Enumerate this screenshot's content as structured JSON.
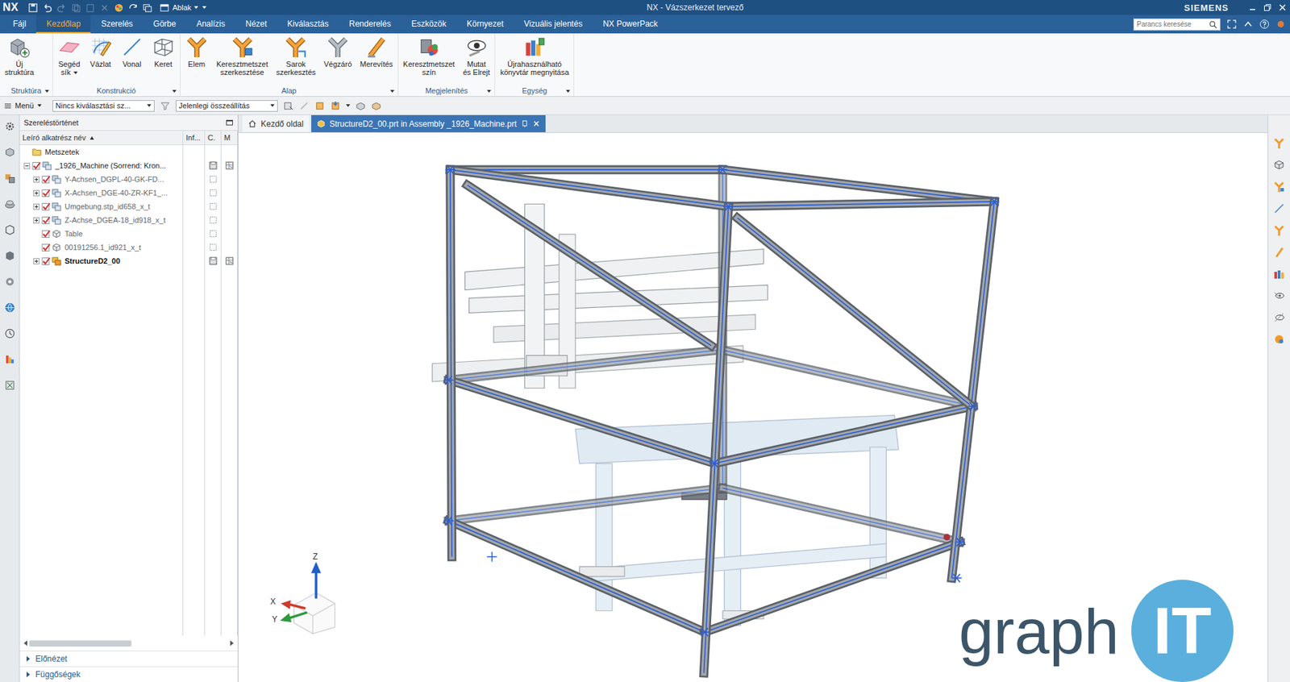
{
  "window": {
    "app": "NX",
    "title": "NX - Vázszerkezet tervező",
    "brand": "SIEMENS",
    "quick_menu": "Ablak"
  },
  "menu_tabs": [
    {
      "label": "Fájl",
      "selected": false
    },
    {
      "label": "Kezdőlap",
      "selected": true
    },
    {
      "label": "Szerelés",
      "selected": false
    },
    {
      "label": "Görbe",
      "selected": false
    },
    {
      "label": "Analízis",
      "selected": false
    },
    {
      "label": "Nézet",
      "selected": false
    },
    {
      "label": "Kiválasztás",
      "selected": false
    },
    {
      "label": "Renderelés",
      "selected": false
    },
    {
      "label": "Eszközök",
      "selected": false
    },
    {
      "label": "Környezet",
      "selected": false
    },
    {
      "label": "Vizuális jelentés",
      "selected": false
    },
    {
      "label": "NX PowerPack",
      "selected": false
    }
  ],
  "command_search": {
    "placeholder": "Parancs keresése"
  },
  "ribbon_groups": [
    {
      "label": "Struktúra",
      "has_menu": true,
      "commands": [
        {
          "label": "Új\nstruktúra",
          "kind": "structure",
          "has_menu": false
        }
      ]
    },
    {
      "label": "Konstrukció",
      "has_menu": true,
      "commands": [
        {
          "label": "Segéd\nsík",
          "kind": "plane",
          "has_menu": true
        },
        {
          "label": "Vázlat",
          "kind": "sketch",
          "has_menu": false
        },
        {
          "label": "Vonal",
          "kind": "line",
          "has_menu": false
        },
        {
          "label": "Keret",
          "kind": "frame",
          "has_menu": false
        }
      ]
    },
    {
      "label": "Alap",
      "has_menu": true,
      "commands": [
        {
          "label": "Elem",
          "kind": "member",
          "has_menu": false
        },
        {
          "label": "Keresztmetszet\nszerkesztése",
          "kind": "section",
          "has_menu": false
        },
        {
          "label": "Sarok\nszerkesztés",
          "kind": "corner",
          "has_menu": false
        },
        {
          "label": "Végzáró",
          "kind": "endcap",
          "has_menu": false
        },
        {
          "label": "Merevítés",
          "kind": "brace",
          "has_menu": false
        }
      ]
    },
    {
      "label": "Megjelenítés",
      "has_menu": true,
      "commands": [
        {
          "label": "Keresztmetszet\nszín",
          "kind": "color",
          "has_menu": false
        },
        {
          "label": "Mutat\nés Elrejt",
          "kind": "showhide",
          "has_menu": false
        }
      ]
    },
    {
      "label": "Egység",
      "has_menu": true,
      "commands": [
        {
          "label": "Újrahasználható\nkönyvtár megnyitása",
          "kind": "library",
          "has_menu": false
        }
      ]
    }
  ],
  "selection_bar": {
    "menu": "Menü",
    "filters": [
      "Nincs kiválasztási sz...",
      "Jelenlegi összeállítás"
    ]
  },
  "navigator": {
    "title": "Szereléstörténet",
    "columns": [
      {
        "label": "Leíró alkatrész név",
        "sort": "asc"
      },
      {
        "label": "Inf...",
        "sort": "none"
      },
      {
        "label": "C.",
        "sort": "none"
      },
      {
        "label": "M",
        "sort": "none"
      }
    ],
    "rows": [
      {
        "name": "Metszetek",
        "depth": 0,
        "expander": "none",
        "has_check": false,
        "checked": false,
        "kind": "folder",
        "dimmed": false,
        "work_part": false,
        "c_mark": "none",
        "m_mark": false
      },
      {
        "name": "_1926_Machine (Sorrend: Kron...",
        "depth": 0,
        "expander": "expanded",
        "has_check": true,
        "checked": true,
        "kind": "assembly",
        "dimmed": false,
        "work_part": false,
        "c_mark": "save",
        "m_mark": true
      },
      {
        "name": "Y-Achsen_DGPL-40-GK-FD...",
        "depth": 1,
        "expander": "collapsed",
        "has_check": true,
        "checked": true,
        "kind": "assembly",
        "dimmed": true,
        "work_part": false,
        "c_mark": "box",
        "m_mark": false
      },
      {
        "name": "X-Achsen_DGE-40-ZR-KF1_...",
        "depth": 1,
        "expander": "collapsed",
        "has_check": true,
        "checked": true,
        "kind": "assembly",
        "dimmed": true,
        "work_part": false,
        "c_mark": "box",
        "m_mark": false
      },
      {
        "name": "Umgebung.stp_id658_x_t",
        "depth": 1,
        "expander": "collapsed",
        "has_check": true,
        "checked": true,
        "kind": "assembly",
        "dimmed": true,
        "work_part": false,
        "c_mark": "box",
        "m_mark": false
      },
      {
        "name": "Z-Achse_DGEA-18_id918_x_t",
        "depth": 1,
        "expander": "collapsed",
        "has_check": true,
        "checked": true,
        "kind": "assembly",
        "dimmed": true,
        "work_part": false,
        "c_mark": "box",
        "m_mark": false
      },
      {
        "name": "Table",
        "depth": 1,
        "expander": "none",
        "has_check": true,
        "checked": true,
        "kind": "component",
        "dimmed": true,
        "work_part": false,
        "c_mark": "box",
        "m_mark": false
      },
      {
        "name": "00191256.1_id921_x_t",
        "depth": 1,
        "expander": "none",
        "has_check": true,
        "checked": true,
        "kind": "component",
        "dimmed": true,
        "work_part": false,
        "c_mark": "box",
        "m_mark": false
      },
      {
        "name": "StructureD2_00",
        "depth": 1,
        "expander": "collapsed",
        "has_check": true,
        "checked": true,
        "kind": "work",
        "dimmed": false,
        "work_part": true,
        "c_mark": "save",
        "m_mark": true
      }
    ],
    "panels": [
      {
        "label": "Előnézet",
        "expanded": false
      },
      {
        "label": "Függőségek",
        "expanded": false
      }
    ]
  },
  "viewport": {
    "tabs": [
      {
        "label": "Kezdő oldal",
        "kind": "home",
        "selected": false
      },
      {
        "label": "StructureD2_00.prt in Assembly _1926_Machine.prt",
        "kind": "part",
        "selected": true
      }
    ],
    "triad": {
      "x": "X",
      "y": "Y",
      "z": "Z"
    }
  },
  "watermark": {
    "text": "graph",
    "badge": "IT"
  }
}
